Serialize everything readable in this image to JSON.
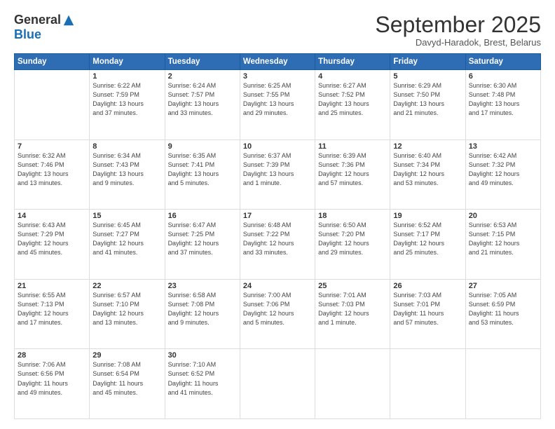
{
  "header": {
    "logo_general": "General",
    "logo_blue": "Blue",
    "month_title": "September 2025",
    "subtitle": "Davyd-Haradok, Brest, Belarus"
  },
  "days_of_week": [
    "Sunday",
    "Monday",
    "Tuesday",
    "Wednesday",
    "Thursday",
    "Friday",
    "Saturday"
  ],
  "weeks": [
    [
      {
        "day": "",
        "info": ""
      },
      {
        "day": "1",
        "info": "Sunrise: 6:22 AM\nSunset: 7:59 PM\nDaylight: 13 hours\nand 37 minutes."
      },
      {
        "day": "2",
        "info": "Sunrise: 6:24 AM\nSunset: 7:57 PM\nDaylight: 13 hours\nand 33 minutes."
      },
      {
        "day": "3",
        "info": "Sunrise: 6:25 AM\nSunset: 7:55 PM\nDaylight: 13 hours\nand 29 minutes."
      },
      {
        "day": "4",
        "info": "Sunrise: 6:27 AM\nSunset: 7:52 PM\nDaylight: 13 hours\nand 25 minutes."
      },
      {
        "day": "5",
        "info": "Sunrise: 6:29 AM\nSunset: 7:50 PM\nDaylight: 13 hours\nand 21 minutes."
      },
      {
        "day": "6",
        "info": "Sunrise: 6:30 AM\nSunset: 7:48 PM\nDaylight: 13 hours\nand 17 minutes."
      }
    ],
    [
      {
        "day": "7",
        "info": "Sunrise: 6:32 AM\nSunset: 7:46 PM\nDaylight: 13 hours\nand 13 minutes."
      },
      {
        "day": "8",
        "info": "Sunrise: 6:34 AM\nSunset: 7:43 PM\nDaylight: 13 hours\nand 9 minutes."
      },
      {
        "day": "9",
        "info": "Sunrise: 6:35 AM\nSunset: 7:41 PM\nDaylight: 13 hours\nand 5 minutes."
      },
      {
        "day": "10",
        "info": "Sunrise: 6:37 AM\nSunset: 7:39 PM\nDaylight: 13 hours\nand 1 minute."
      },
      {
        "day": "11",
        "info": "Sunrise: 6:39 AM\nSunset: 7:36 PM\nDaylight: 12 hours\nand 57 minutes."
      },
      {
        "day": "12",
        "info": "Sunrise: 6:40 AM\nSunset: 7:34 PM\nDaylight: 12 hours\nand 53 minutes."
      },
      {
        "day": "13",
        "info": "Sunrise: 6:42 AM\nSunset: 7:32 PM\nDaylight: 12 hours\nand 49 minutes."
      }
    ],
    [
      {
        "day": "14",
        "info": "Sunrise: 6:43 AM\nSunset: 7:29 PM\nDaylight: 12 hours\nand 45 minutes."
      },
      {
        "day": "15",
        "info": "Sunrise: 6:45 AM\nSunset: 7:27 PM\nDaylight: 12 hours\nand 41 minutes."
      },
      {
        "day": "16",
        "info": "Sunrise: 6:47 AM\nSunset: 7:25 PM\nDaylight: 12 hours\nand 37 minutes."
      },
      {
        "day": "17",
        "info": "Sunrise: 6:48 AM\nSunset: 7:22 PM\nDaylight: 12 hours\nand 33 minutes."
      },
      {
        "day": "18",
        "info": "Sunrise: 6:50 AM\nSunset: 7:20 PM\nDaylight: 12 hours\nand 29 minutes."
      },
      {
        "day": "19",
        "info": "Sunrise: 6:52 AM\nSunset: 7:17 PM\nDaylight: 12 hours\nand 25 minutes."
      },
      {
        "day": "20",
        "info": "Sunrise: 6:53 AM\nSunset: 7:15 PM\nDaylight: 12 hours\nand 21 minutes."
      }
    ],
    [
      {
        "day": "21",
        "info": "Sunrise: 6:55 AM\nSunset: 7:13 PM\nDaylight: 12 hours\nand 17 minutes."
      },
      {
        "day": "22",
        "info": "Sunrise: 6:57 AM\nSunset: 7:10 PM\nDaylight: 12 hours\nand 13 minutes."
      },
      {
        "day": "23",
        "info": "Sunrise: 6:58 AM\nSunset: 7:08 PM\nDaylight: 12 hours\nand 9 minutes."
      },
      {
        "day": "24",
        "info": "Sunrise: 7:00 AM\nSunset: 7:06 PM\nDaylight: 12 hours\nand 5 minutes."
      },
      {
        "day": "25",
        "info": "Sunrise: 7:01 AM\nSunset: 7:03 PM\nDaylight: 12 hours\nand 1 minute."
      },
      {
        "day": "26",
        "info": "Sunrise: 7:03 AM\nSunset: 7:01 PM\nDaylight: 11 hours\nand 57 minutes."
      },
      {
        "day": "27",
        "info": "Sunrise: 7:05 AM\nSunset: 6:59 PM\nDaylight: 11 hours\nand 53 minutes."
      }
    ],
    [
      {
        "day": "28",
        "info": "Sunrise: 7:06 AM\nSunset: 6:56 PM\nDaylight: 11 hours\nand 49 minutes."
      },
      {
        "day": "29",
        "info": "Sunrise: 7:08 AM\nSunset: 6:54 PM\nDaylight: 11 hours\nand 45 minutes."
      },
      {
        "day": "30",
        "info": "Sunrise: 7:10 AM\nSunset: 6:52 PM\nDaylight: 11 hours\nand 41 minutes."
      },
      {
        "day": "",
        "info": ""
      },
      {
        "day": "",
        "info": ""
      },
      {
        "day": "",
        "info": ""
      },
      {
        "day": "",
        "info": ""
      }
    ]
  ]
}
